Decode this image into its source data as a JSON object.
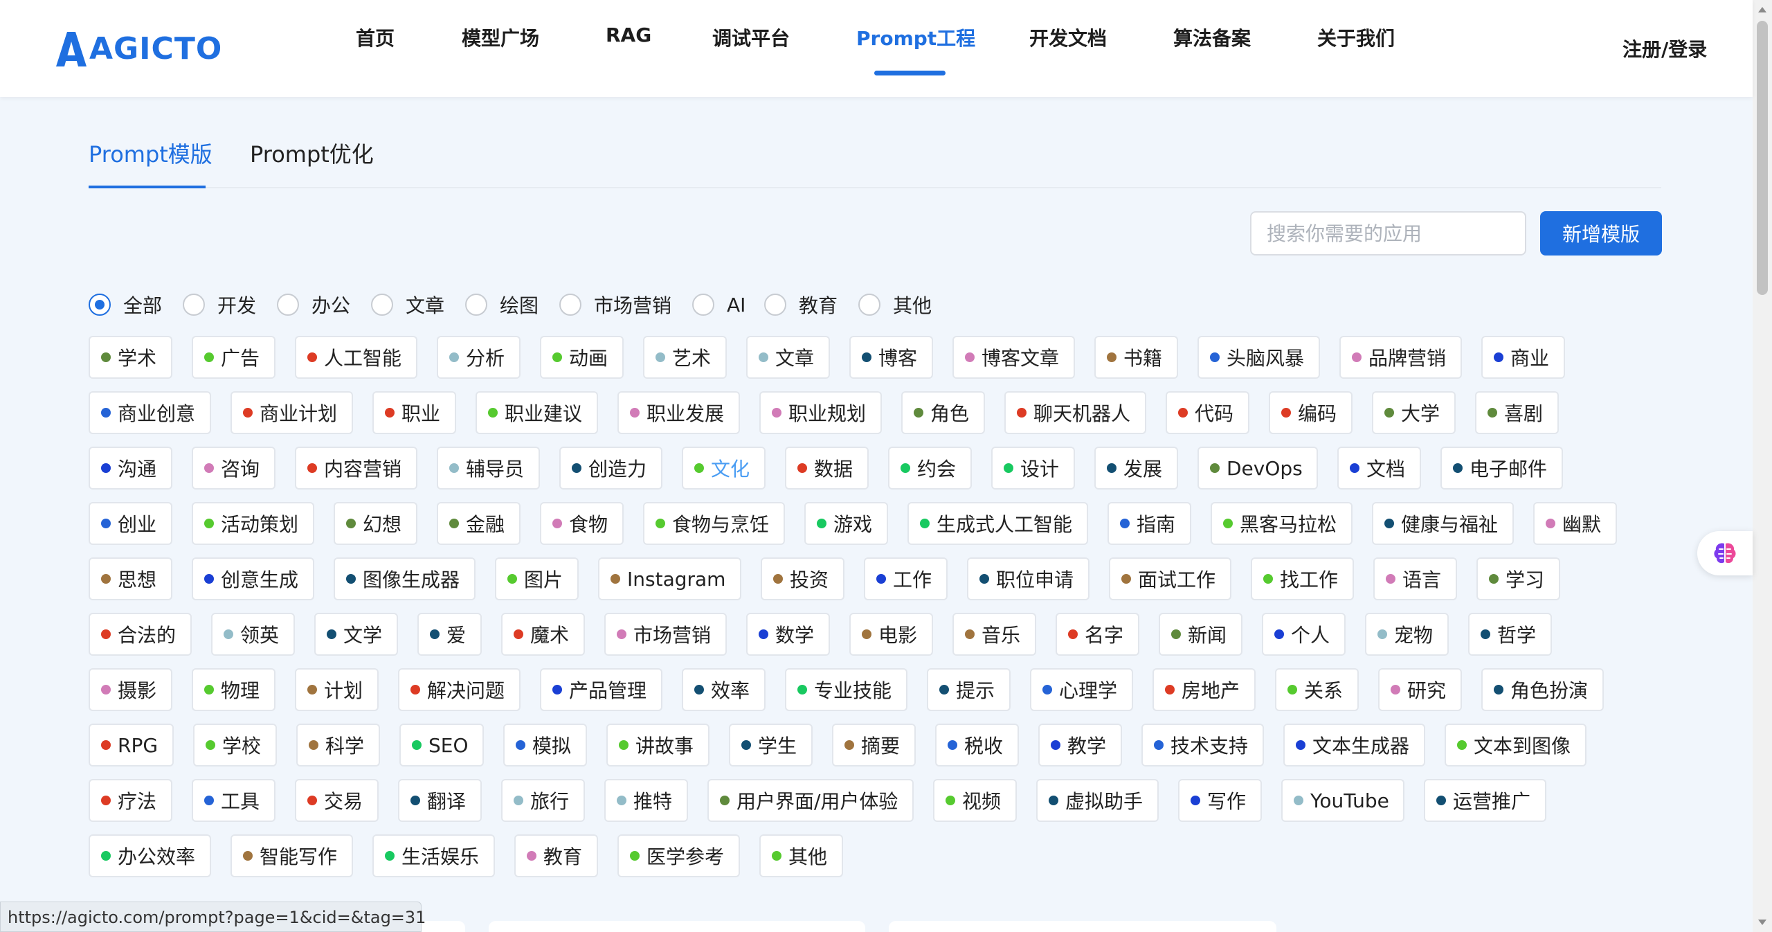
{
  "brand": {
    "name": "AGICTO",
    "color": "#1f6fe0"
  },
  "nav": {
    "items": [
      {
        "label": "首页",
        "active": false
      },
      {
        "label": "模型广场",
        "active": false
      },
      {
        "label": "RAG",
        "active": false
      },
      {
        "label": "调试平台",
        "active": false
      },
      {
        "label": "Prompt工程",
        "active": true
      },
      {
        "label": "开发文档",
        "active": false
      },
      {
        "label": "算法备案",
        "active": false
      },
      {
        "label": "关于我们",
        "active": false
      }
    ],
    "login_label": "注册/登录"
  },
  "tabs": [
    {
      "label": "Prompt模版",
      "active": true
    },
    {
      "label": "Prompt优化",
      "active": false
    }
  ],
  "search": {
    "placeholder": "搜索你需要的应用",
    "value": ""
  },
  "add_button_label": "新增模版",
  "categories": [
    {
      "label": "全部",
      "checked": true
    },
    {
      "label": "开发",
      "checked": false
    },
    {
      "label": "办公",
      "checked": false
    },
    {
      "label": "文章",
      "checked": false
    },
    {
      "label": "绘图",
      "checked": false
    },
    {
      "label": "市场营销",
      "checked": false
    },
    {
      "label": "AI",
      "checked": false
    },
    {
      "label": "教育",
      "checked": false
    },
    {
      "label": "其他",
      "checked": false
    }
  ],
  "tag_colors": {
    "g": "#56ca2f",
    "o": "#5f8a3c",
    "r": "#dd3b24",
    "b": "#2563d6",
    "n": "#1a3fd4",
    "t": "#134f72",
    "p": "#d17bb7",
    "w": "#a0743e",
    "s": "#93bcc8",
    "m": "#18c960"
  },
  "tag_rows": [
    [
      [
        "学术",
        "o"
      ],
      [
        "广告",
        "g"
      ],
      [
        "人工智能",
        "r"
      ],
      [
        "分析",
        "s"
      ],
      [
        "动画",
        "g"
      ],
      [
        "艺术",
        "s"
      ],
      [
        "文章",
        "s"
      ],
      [
        "博客",
        "t"
      ],
      [
        "博客文章",
        "p"
      ],
      [
        "书籍",
        "w"
      ],
      [
        "头脑风暴",
        "b"
      ],
      [
        "品牌营销",
        "p"
      ],
      [
        "商业",
        "n"
      ]
    ],
    [
      [
        "商业创意",
        "b"
      ],
      [
        "商业计划",
        "r"
      ],
      [
        "职业",
        "r"
      ],
      [
        "职业建议",
        "g"
      ],
      [
        "职业发展",
        "p"
      ],
      [
        "职业规划",
        "p"
      ],
      [
        "角色",
        "o"
      ],
      [
        "聊天机器人",
        "r"
      ],
      [
        "代码",
        "r"
      ],
      [
        "编码",
        "r"
      ],
      [
        "大学",
        "o"
      ],
      [
        "喜剧",
        "o"
      ]
    ],
    [
      [
        "沟通",
        "n"
      ],
      [
        "咨询",
        "p"
      ],
      [
        "内容营销",
        "r"
      ],
      [
        "辅导员",
        "s"
      ],
      [
        "创造力",
        "t"
      ],
      [
        "文化",
        "g"
      ],
      [
        "数据",
        "r"
      ],
      [
        "约会",
        "m"
      ],
      [
        "设计",
        "m"
      ],
      [
        "发展",
        "t"
      ],
      [
        "DevOps",
        "o"
      ],
      [
        "文档",
        "n"
      ],
      [
        "电子邮件",
        "t"
      ]
    ],
    [
      [
        "创业",
        "b"
      ],
      [
        "活动策划",
        "g"
      ],
      [
        "幻想",
        "o"
      ],
      [
        "金融",
        "o"
      ],
      [
        "食物",
        "p"
      ],
      [
        "食物与烹饪",
        "g"
      ],
      [
        "游戏",
        "m"
      ],
      [
        "生成式人工智能",
        "m"
      ],
      [
        "指南",
        "b"
      ],
      [
        "黑客马拉松",
        "g"
      ],
      [
        "健康与福祉",
        "t"
      ],
      [
        "幽默",
        "p"
      ]
    ],
    [
      [
        "思想",
        "w"
      ],
      [
        "创意生成",
        "n"
      ],
      [
        "图像生成器",
        "t"
      ],
      [
        "图片",
        "g"
      ],
      [
        "Instagram",
        "w"
      ],
      [
        "投资",
        "w"
      ],
      [
        "工作",
        "n"
      ],
      [
        "职位申请",
        "t"
      ],
      [
        "面试工作",
        "w"
      ],
      [
        "找工作",
        "g"
      ],
      [
        "语言",
        "p"
      ],
      [
        "学习",
        "o"
      ]
    ],
    [
      [
        "合法的",
        "r"
      ],
      [
        "领英",
        "s"
      ],
      [
        "文学",
        "t"
      ],
      [
        "爱",
        "t"
      ],
      [
        "魔术",
        "r"
      ],
      [
        "市场营销",
        "p"
      ],
      [
        "数学",
        "n"
      ],
      [
        "电影",
        "w"
      ],
      [
        "音乐",
        "w"
      ],
      [
        "名字",
        "r"
      ],
      [
        "新闻",
        "o"
      ],
      [
        "个人",
        "n"
      ],
      [
        "宠物",
        "s"
      ],
      [
        "哲学",
        "t"
      ]
    ],
    [
      [
        "摄影",
        "p"
      ],
      [
        "物理",
        "g"
      ],
      [
        "计划",
        "w"
      ],
      [
        "解决问题",
        "r"
      ],
      [
        "产品管理",
        "n"
      ],
      [
        "效率",
        "t"
      ],
      [
        "专业技能",
        "m"
      ],
      [
        "提示",
        "t"
      ],
      [
        "心理学",
        "b"
      ],
      [
        "房地产",
        "r"
      ],
      [
        "关系",
        "g"
      ],
      [
        "研究",
        "p"
      ],
      [
        "角色扮演",
        "t"
      ]
    ],
    [
      [
        "RPG",
        "r"
      ],
      [
        "学校",
        "g"
      ],
      [
        "科学",
        "w"
      ],
      [
        "SEO",
        "m"
      ],
      [
        "模拟",
        "b"
      ],
      [
        "讲故事",
        "g"
      ],
      [
        "学生",
        "t"
      ],
      [
        "摘要",
        "w"
      ],
      [
        "税收",
        "b"
      ],
      [
        "教学",
        "n"
      ],
      [
        "技术支持",
        "b"
      ],
      [
        "文本生成器",
        "n"
      ],
      [
        "文本到图像",
        "g"
      ]
    ],
    [
      [
        "疗法",
        "r"
      ],
      [
        "工具",
        "b"
      ],
      [
        "交易",
        "r"
      ],
      [
        "翻译",
        "t"
      ],
      [
        "旅行",
        "s"
      ],
      [
        "推特",
        "s"
      ],
      [
        "用户界面/用户体验",
        "o"
      ],
      [
        "视频",
        "g"
      ],
      [
        "虚拟助手",
        "t"
      ],
      [
        "写作",
        "n"
      ],
      [
        "YouTube",
        "s"
      ],
      [
        "运营推广",
        "t"
      ]
    ],
    [
      [
        "办公效率",
        "m"
      ],
      [
        "智能写作",
        "w"
      ],
      [
        "生活娱乐",
        "m"
      ],
      [
        "教育",
        "p"
      ],
      [
        "医学参考",
        "g"
      ],
      [
        "其他",
        "g"
      ]
    ]
  ],
  "highlighted_tag": "文化",
  "status_bar_url": "https://agicto.com/prompt?page=1&cid=&tag=31"
}
